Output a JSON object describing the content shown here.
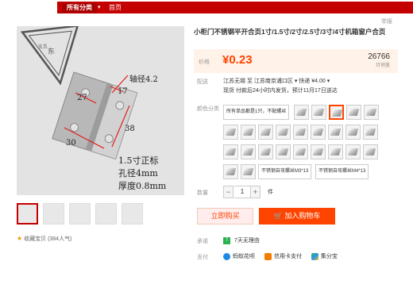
{
  "topnav": {
    "category": "所有分类",
    "home": "首页"
  },
  "report": "举报",
  "product": {
    "title": "小柜门不锈钢平开合页1寸/1.5寸/2寸/2.5寸/3寸/4寸机箱窗户合页",
    "image_text": {
      "axis_label": "轴径4.2",
      "dim_27": "27",
      "dim_17": "17",
      "dim_30": "30",
      "dim_38": "38",
      "spec_1": "1.5寸正标",
      "spec_2": "孔径4mm",
      "spec_3": "厚度0.8mm"
    }
  },
  "price": {
    "label": "价格",
    "value": "¥0.23",
    "sold_count": "26766",
    "sold_label": "月销量"
  },
  "delivery": {
    "label": "配送",
    "line1": "江苏无锡 至 江苏南京浦口区 ▾  快递 ¥4.00 ▾",
    "line2": "现货 付款后24小时内发货，预计11月17日送达"
  },
  "color": {
    "label": "颜色分类",
    "opt_first": "所有单品都是1只，不配螺丝",
    "opt_screw1": "不锈钢自攻螺丝M3*13",
    "opt_screw2": "不锈钢自攻螺丝M4*13"
  },
  "quantity": {
    "label": "数量",
    "minus": "−",
    "value": "1",
    "plus": "+",
    "unit": "件"
  },
  "buttons": {
    "buy_now": "立即购买",
    "add_cart": "加入购物车"
  },
  "promise": {
    "label": "承诺",
    "badge": "7",
    "text": "7天无理由"
  },
  "payment": {
    "label": "支付",
    "items": [
      "蚂蚁花呗",
      "信用卡支付",
      "集分宝"
    ]
  },
  "favorite": {
    "star": "★",
    "text": "收藏宝贝 (384人气)"
  },
  "colors": {
    "accent": "#ff4400",
    "brand_red": "#c40000",
    "price_bg": "#fff2e8"
  }
}
